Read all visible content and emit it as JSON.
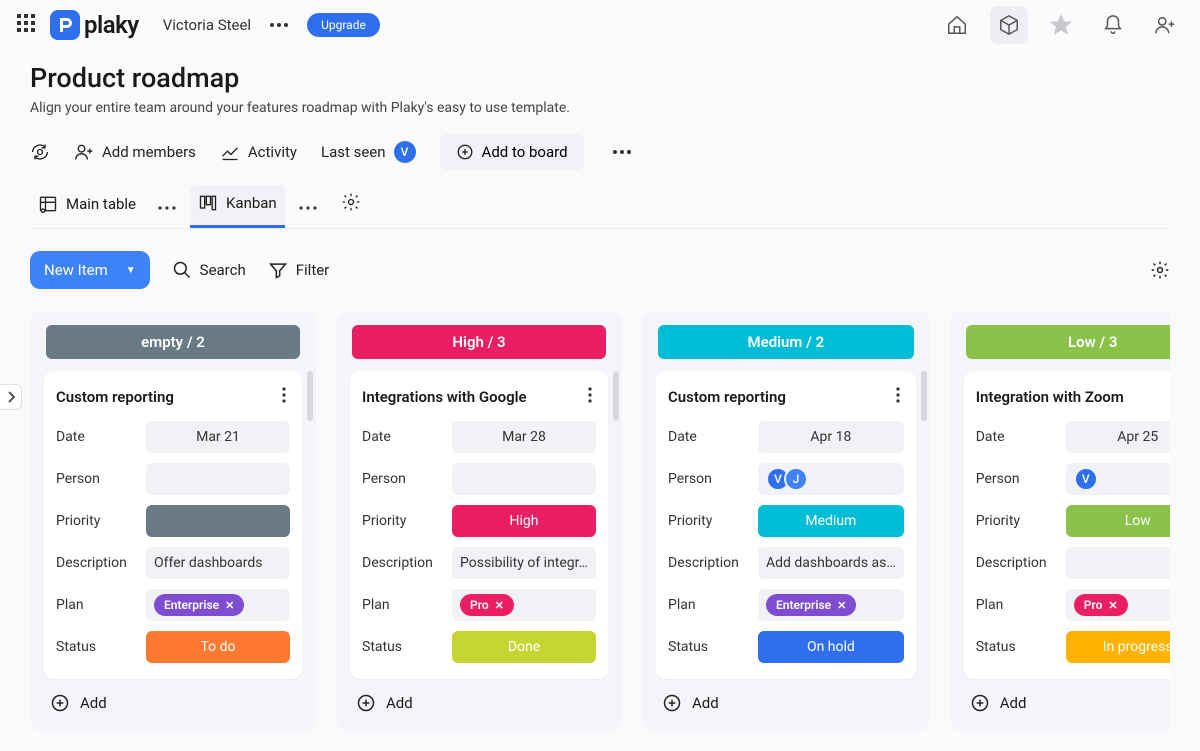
{
  "topbar": {
    "logo_text": "plaky",
    "user": "Victoria Steel",
    "upgrade": "Upgrade"
  },
  "header": {
    "title": "Product roadmap",
    "subtitle": "Align your entire team around your features roadmap with Plaky's easy to use template.",
    "add_members": "Add members",
    "activity": "Activity",
    "last_seen": "Last seen",
    "last_seen_initial": "V",
    "add_to_board": "Add to board"
  },
  "views": {
    "main_table": "Main table",
    "kanban": "Kanban"
  },
  "toolbar": {
    "new_item": "New Item",
    "search": "Search",
    "filter": "Filter"
  },
  "fields": {
    "date": "Date",
    "person": "Person",
    "priority": "Priority",
    "description": "Description",
    "plan": "Plan",
    "status": "Status"
  },
  "add_label": "Add",
  "columns": [
    {
      "header": "empty / 2",
      "class": "empty",
      "card": {
        "title": "Custom reporting",
        "date": "Mar 21",
        "persons": [],
        "priority": "",
        "priority_class": "empty-gray",
        "description": "Offer dashboards",
        "plan": "Enterprise",
        "plan_class": "enterprise",
        "status": "To do",
        "status_class": "todo"
      }
    },
    {
      "header": "High / 3",
      "class": "high",
      "card": {
        "title": "Integrations with Google",
        "date": "Mar 28",
        "persons": [],
        "priority": "High",
        "priority_class": "high",
        "description": "Possibility of integr…",
        "plan": "Pro",
        "plan_class": "pro",
        "status": "Done",
        "status_class": "done"
      }
    },
    {
      "header": "Medium / 2",
      "class": "medium",
      "card": {
        "title": "Custom reporting",
        "date": "Apr 18",
        "persons": [
          "V",
          "J"
        ],
        "priority": "Medium",
        "priority_class": "medium",
        "description": "Add dashboards as…",
        "plan": "Enterprise",
        "plan_class": "enterprise",
        "status": "On hold",
        "status_class": "onhold"
      }
    },
    {
      "header": "Low / 3",
      "class": "low",
      "card": {
        "title": "Integration with Zoom",
        "date": "Apr 25",
        "persons": [
          "V"
        ],
        "priority": "Low",
        "priority_class": "low",
        "description": "",
        "plan": "Pro",
        "plan_class": "pro",
        "status": "In progress",
        "status_class": "inprogress"
      }
    }
  ]
}
